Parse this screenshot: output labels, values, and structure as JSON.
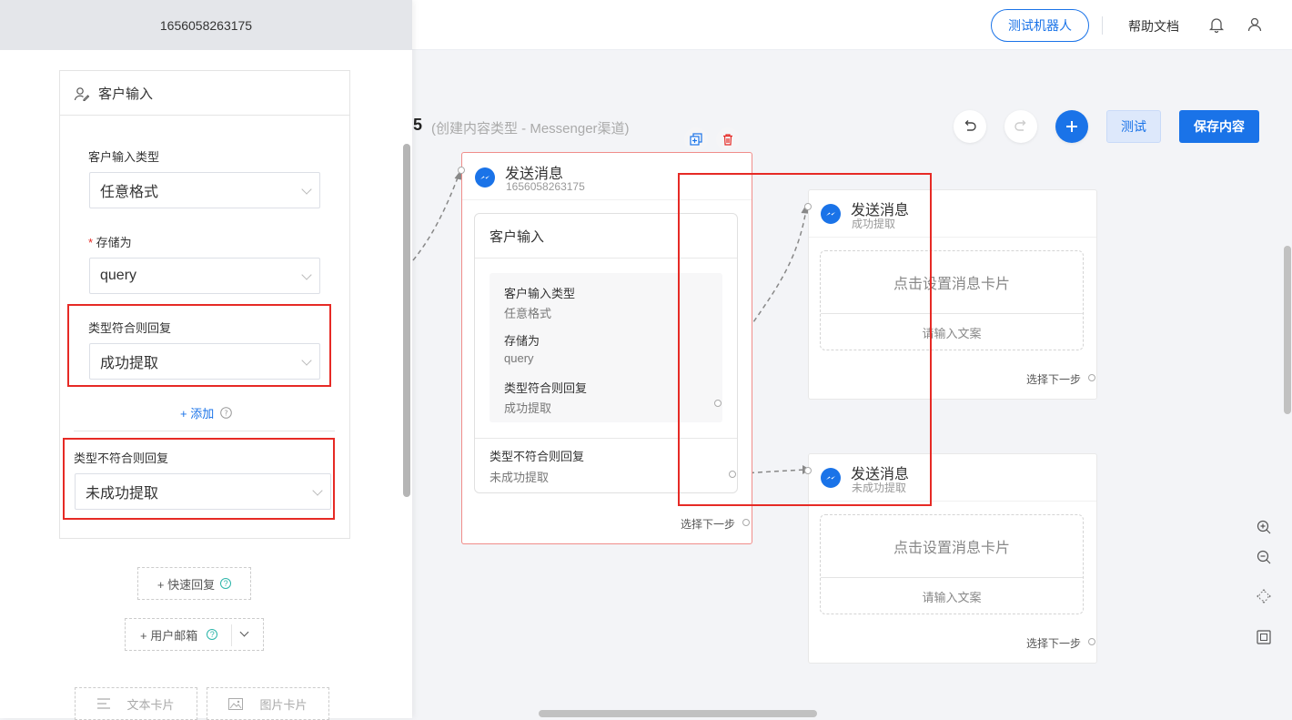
{
  "topbar": {
    "test_robot_label": "测试机器人",
    "help_label": "帮助文档",
    "bell_icon": "bell-icon",
    "user_icon": "user-icon"
  },
  "toolbar": {
    "flow_number": "5",
    "flow_subtitle": "(创建内容类型 - Messenger渠道)",
    "test_label": "测试",
    "save_label": "保存内容"
  },
  "nodes": [
    {
      "title": "发送消息",
      "subtitle": "1656058263175",
      "inner": {
        "header": "客户输入",
        "type_label": "客户输入类型",
        "type_value": "任意格式",
        "store_label": "存储为",
        "store_value": "query",
        "match_label": "类型符合则回复",
        "match_value": "成功提取",
        "nomatch_label": "类型不符合则回复",
        "nomatch_value": "未成功提取"
      },
      "next_label": "选择下一步"
    },
    {
      "title": "发送消息",
      "subtitle": "成功提取",
      "card_label": "点击设置消息卡片",
      "text_placeholder": "请输入文案",
      "next_label": "选择下一步"
    },
    {
      "title": "发送消息",
      "subtitle": "未成功提取",
      "card_label": "点击设置消息卡片",
      "text_placeholder": "请输入文案",
      "next_label": "选择下一步"
    }
  ],
  "panel": {
    "header_id": "1656058263175",
    "card_title": "客户输入",
    "input_type_label": "客户输入类型",
    "input_type_value": "任意格式",
    "store_label": "存储为",
    "store_value": "query",
    "match_label": "类型符合则回复",
    "match_value": "成功提取",
    "add_label": "+ 添加",
    "nomatch_label": "类型不符合则回复",
    "nomatch_value": "未成功提取",
    "quick_reply_label": "+ 快速回复",
    "user_email_label": "+ 用户邮箱",
    "text_card_label": "文本卡片",
    "image_card_label": "图片卡片"
  },
  "colors": {
    "primary": "#1a73e8",
    "highlight_red": "#e62a25"
  }
}
